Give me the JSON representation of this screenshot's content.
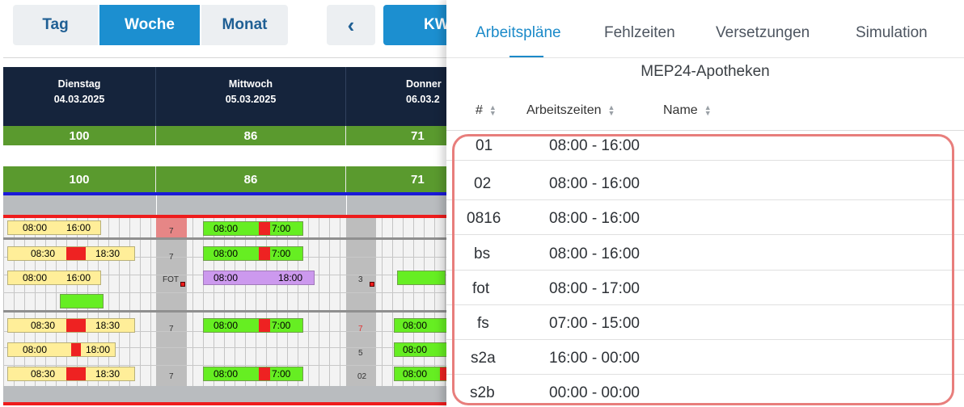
{
  "view_buttons": {
    "tag": "Tag",
    "woche": "Woche",
    "monat": "Monat",
    "prev": "‹",
    "kw": "KW"
  },
  "days": [
    {
      "name": "Dienstag",
      "date": "04.03.2025",
      "sum1": "100",
      "sum2": "100"
    },
    {
      "name": "Mittwoch",
      "date": "05.03.2025",
      "sum1": "86",
      "sum2": "86"
    },
    {
      "name": "Donner",
      "date": "06.03.2",
      "sum1": "71",
      "sum2": "71"
    }
  ],
  "schedule": {
    "times": {
      "r1a": "08:00",
      "r1b": "16:00",
      "r2a": "08:30",
      "r2b": "18:30",
      "r3a": "08:00",
      "r3b": "16:00",
      "r5a": "08:30",
      "r5b": "18:30",
      "r6a": "08:00",
      "r6b": "18:00",
      "r7a": "08:30",
      "r7b": "18:30",
      "m1a": "08:00",
      "m1b": "7:00",
      "m2a": "08:00",
      "m2b": "7:00",
      "m3a": "08:00",
      "m3b": "18:00",
      "m5a": "08:00",
      "m5b": "7:00",
      "m7a": "08:00",
      "m7b": "7:00",
      "d5a": "08:00",
      "d6a": "08:00",
      "d7a": "08:00"
    },
    "small": {
      "a": "7",
      "b": "7",
      "c": "FOT",
      "d": "7",
      "e": "7",
      "f": "3",
      "g": "7",
      "h": "5",
      "i": "02"
    }
  },
  "panel": {
    "tabs": [
      "Arbeitspläne",
      "Fehlzeiten",
      "Versetzungen",
      "Simulation"
    ],
    "title": "MEP24-Apotheken",
    "columns": [
      "#",
      "Arbeitszeiten",
      "Name"
    ],
    "rows": [
      {
        "id": "01",
        "time": "08:00 - 16:00"
      },
      {
        "id": "02",
        "time": "08:00 - 16:00"
      },
      {
        "id": "0816",
        "time": "08:00 - 16:00"
      },
      {
        "id": "bs",
        "time": "08:00 - 16:00"
      },
      {
        "id": "fot",
        "time": "08:00 - 17:00"
      },
      {
        "id": "fs",
        "time": "07:00 - 15:00"
      },
      {
        "id": "s2a",
        "time": "16:00 - 00:00"
      },
      {
        "id": "s2b",
        "time": "00:00 - 00:00"
      }
    ]
  },
  "colors": {
    "accent": "#1b8ac9",
    "highlight": "#e87e7c",
    "header": "#15243c",
    "sum": "#5a9a2e"
  }
}
